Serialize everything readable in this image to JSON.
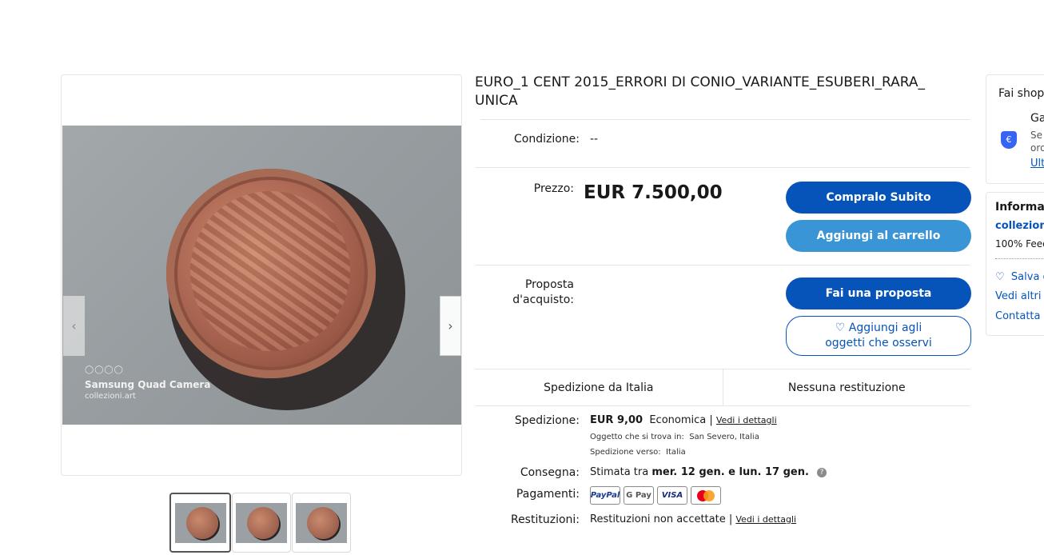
{
  "listing": {
    "title": "EURO_1 CENT 2015_ERRORI DI CONIO_VARIANTE_ESUBERI_RARA_ UNICA",
    "condition_label": "Condizione:",
    "condition_value": "--",
    "price_label": "Prezzo:",
    "price_value": "EUR 7.500,00",
    "offer_label_1": "Proposta",
    "offer_label_2": "d'acquisto:"
  },
  "buttons": {
    "buy_now": "Compralo Subito",
    "add_to_cart": "Aggiungi al carrello",
    "make_offer": "Fai una proposta",
    "watch_line1": "Aggiungi agli",
    "watch_line2": "oggetti che osservi"
  },
  "summary_bar": {
    "shipping_from": "Spedizione da Italia",
    "returns": "Nessuna restituzione"
  },
  "details": {
    "shipping_label": "Spedizione:",
    "shipping_price": "EUR 9,00",
    "shipping_service": "Economica",
    "shipping_link": "Vedi i dettagli",
    "item_location_label": "Oggetto che si trova in:",
    "item_location": "San Severo, Italia",
    "ships_to_label": "Spedizione verso:",
    "ships_to": "Italia",
    "delivery_label": "Consegna:",
    "delivery_prefix": "Stimata tra",
    "delivery_dates": "mer. 12 gen. e lun. 17 gen.",
    "payments_label": "Pagamenti:",
    "payment_methods": [
      "PayPal",
      "G Pay",
      "VISA",
      "Mastercard"
    ],
    "returns_label": "Restituzioni:",
    "returns_value": "Restituzioni non accettate",
    "returns_link": "Vedi i dettagli"
  },
  "photo": {
    "watermark_dots": "◯◯◯◯",
    "watermark_title": "Samsung Quad Camera",
    "watermark_sub": "collezioni.art"
  },
  "side_panel": {
    "shop_title": "Fai shop",
    "guarantee_title": "Ga",
    "guarantee_line1": "Se",
    "guarantee_line2": "ord",
    "guarantee_link": "Ult",
    "seller_header": "Informa",
    "seller_name": "collezioni",
    "seller_feedback": "100% Feed",
    "save_seller": "Salva c",
    "see_other": "Vedi altri o",
    "contact": "Contatta i"
  },
  "colors": {
    "primary_blue": "#0654ba",
    "secondary_blue": "#3a95d6"
  }
}
